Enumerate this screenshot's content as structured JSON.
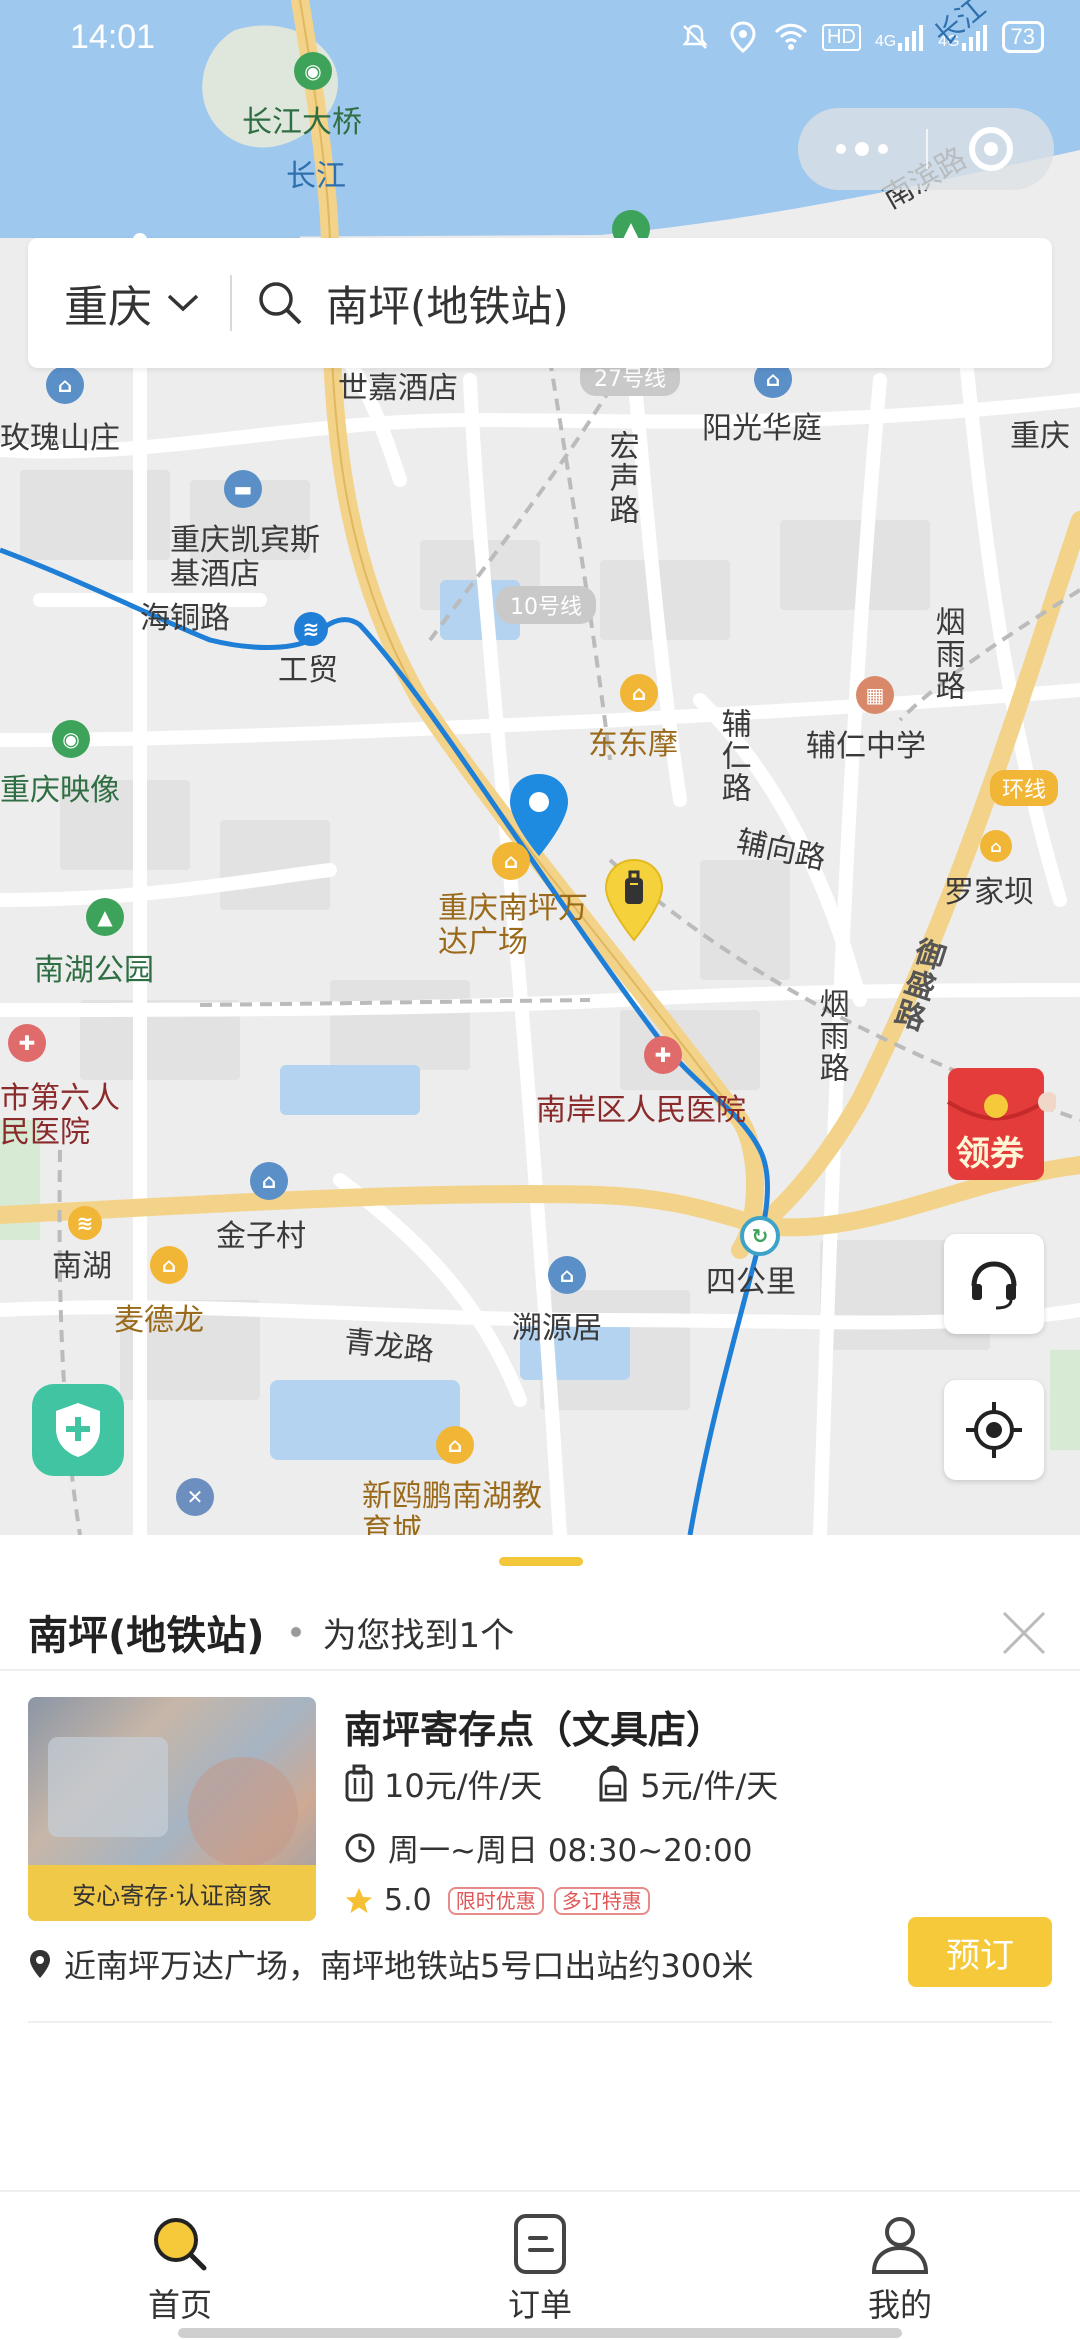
{
  "status_bar": {
    "time": "14:01",
    "signal_labels": [
      "HD",
      "4G",
      "4G"
    ],
    "battery": "73"
  },
  "search": {
    "city": "重庆",
    "query": "南坪(地铁站)"
  },
  "map": {
    "labels": {
      "changjiang_bridge": "长江大桥",
      "changjiang": "长江",
      "changjiang_top": "长江",
      "nanbin_road": "南滨路",
      "shijia_hotel_partial": "世嘉酒店",
      "line27": "27号线",
      "yangguang": "阳光华庭",
      "chongqing_right": "重庆",
      "meigui": "玫瑰山庄",
      "hongsheng_road": "宏声路",
      "kempinski": "重庆凯宾斯基酒店",
      "haitong_road": "海铜路",
      "gongmao": "工贸",
      "line10": "10号线",
      "yanyu_road": "烟雨路",
      "dongdongmo": "东东摩",
      "furen_school": "辅仁中学",
      "furen_road": "辅仁路",
      "fuxiang_road": "辅向路",
      "chongqing_yingxiang": "重庆映像",
      "huanxian": "环线",
      "luojiaba": "罗家坝",
      "wanda": "重庆南坪万达广场",
      "yusheng_road": "御盛路",
      "nanhu_park": "南湖公园",
      "hospital6": "市第六人民医院",
      "nanan_hospital": "南岸区人民医院",
      "yanyu_road2": "烟雨路",
      "jinzicun": "金子村",
      "nanhu": "南湖",
      "mcdonalds": "麦德龙",
      "sigongli": "四公里",
      "suyuanju": "溯源居",
      "qinglong_road": "青龙路",
      "xinoupeng": "新鸥鹏南湖教育城"
    },
    "coupon_label": "领券",
    "colors": {
      "water": "#9ec8ee",
      "road": "#ffffff",
      "arterial": "#f3d38a",
      "metro": "#1f7fd6",
      "land": "#ededed",
      "block": "#e3e3e3"
    }
  },
  "sheet": {
    "title": "南坪(地铁站)",
    "found_text": "为您找到1个",
    "store": {
      "name": "南坪寄存点（文具店）",
      "badge": "安心寄存·认证商家",
      "price_large": "10元/件/天",
      "price_small": "5元/件/天",
      "hours": "周一~周日 08:30~20:00",
      "rating": "5.0",
      "tags": [
        "限时优惠",
        "多订特惠"
      ],
      "address": "近南坪万达广场，南坪地铁站5号口出站约300米",
      "book_label": "预订"
    }
  },
  "tabbar": {
    "tabs": [
      {
        "label": "首页",
        "icon": "search-icon",
        "active": true
      },
      {
        "label": "订单",
        "icon": "order-icon",
        "active": false
      },
      {
        "label": "我的",
        "icon": "user-icon",
        "active": false
      }
    ]
  }
}
